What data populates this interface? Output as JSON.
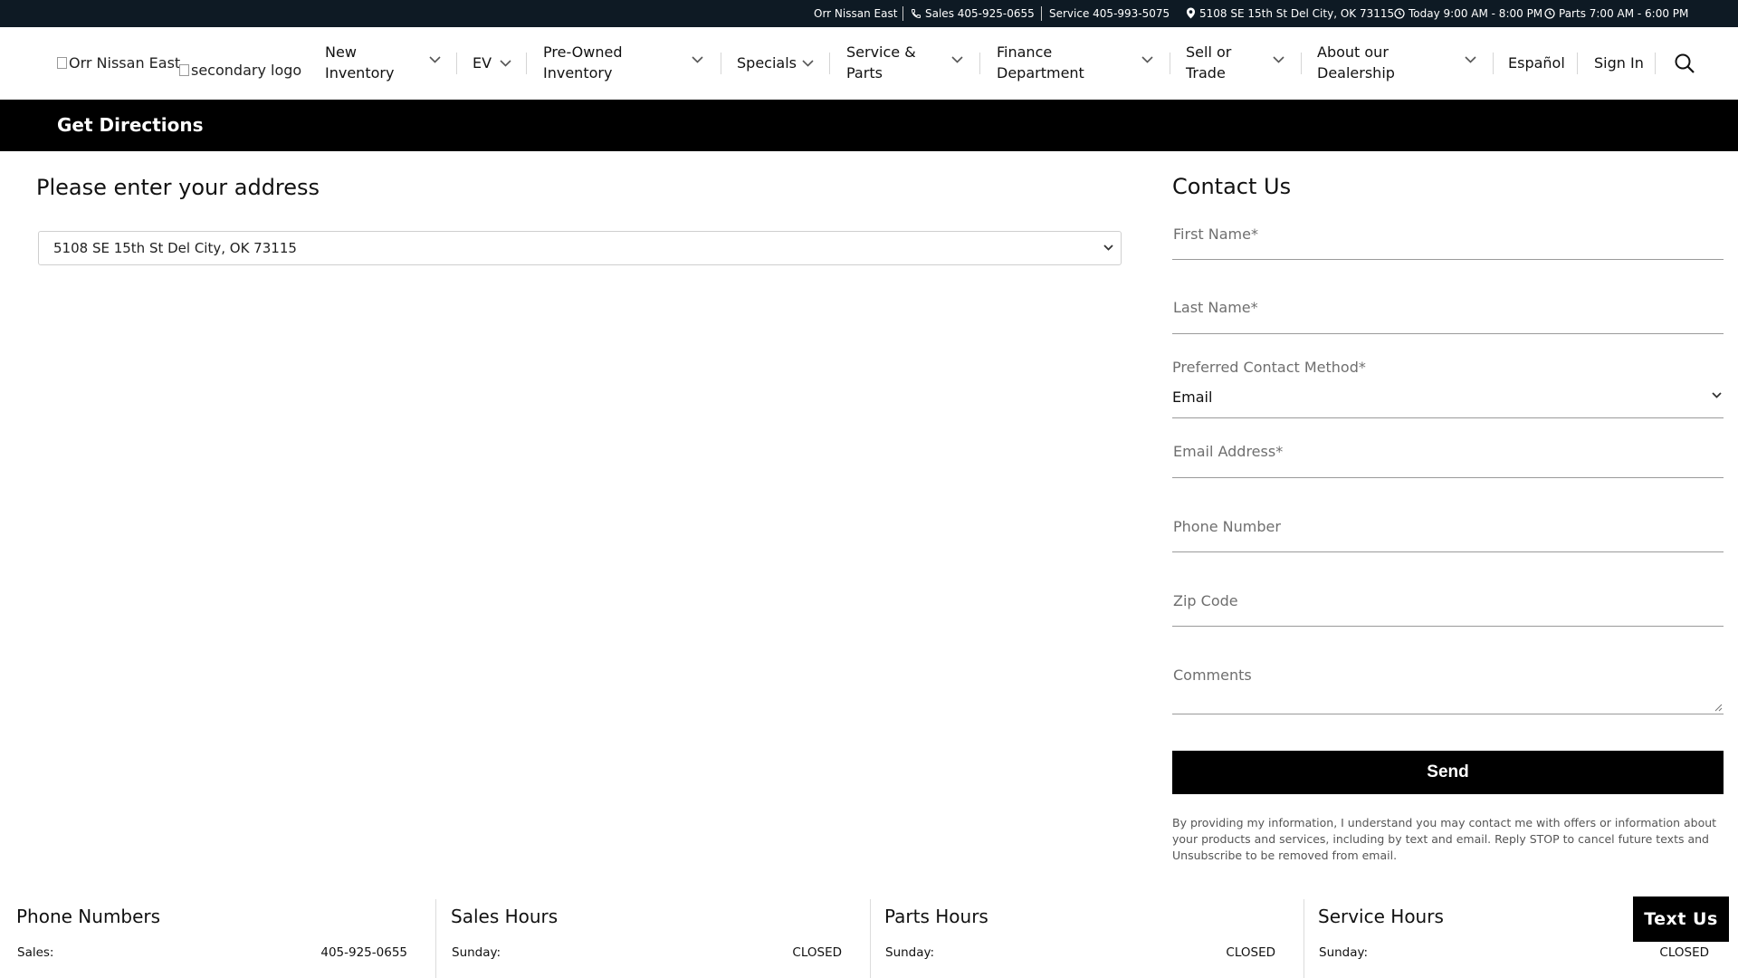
{
  "topbar": {
    "dealer_name": "Orr Nissan East",
    "sales": "Sales 405-925-0655",
    "service": "Service 405-993-5075",
    "address": "5108 SE 15th St Del City, OK 73115",
    "today_hours": "Today 9:00 AM - 8:00 PM",
    "parts_hours": "Parts 7:00 AM - 6:00 PM"
  },
  "header": {
    "logo_alt": "Orr Nissan East",
    "secondary_logo_alt": "secondary logo",
    "nav": [
      {
        "line1": "New",
        "line2": "Inventory"
      },
      {
        "line1": "EV",
        "line2": ""
      },
      {
        "line1": "Pre-Owned",
        "line2": "Inventory"
      },
      {
        "line1": "Specials",
        "line2": ""
      },
      {
        "line1": "Service &",
        "line2": "Parts"
      },
      {
        "line1": "Finance",
        "line2": "Department"
      },
      {
        "line1": "Sell or",
        "line2": "Trade"
      },
      {
        "line1": "About our",
        "line2": "Dealership"
      }
    ],
    "espanol": "Español",
    "sign_in": "Sign In"
  },
  "page": {
    "title": "Get Directions"
  },
  "address_section": {
    "title": "Please enter your address",
    "selected": "5108 SE 15th St Del City, OK 73115"
  },
  "contact": {
    "title": "Contact Us",
    "first_name": "First Name*",
    "last_name": "Last Name*",
    "preferred_label": "Preferred Contact Method*",
    "preferred_value": "Email",
    "email": "Email Address*",
    "phone": "Phone Number",
    "zip": "Zip Code",
    "comments": "Comments",
    "send": "Send",
    "disclaimer": "By providing my information, I understand you may contact me with offers or information about your products and services, including by text and email. Reply STOP to cancel future texts and Unsubscribe to be removed from email."
  },
  "footer": {
    "columns": [
      {
        "title": "Phone Numbers",
        "label": "Sales:",
        "value": "405-925-0655"
      },
      {
        "title": "Sales Hours",
        "label": "Sunday:",
        "value": "CLOSED"
      },
      {
        "title": "Parts Hours",
        "label": "Sunday:",
        "value": "CLOSED"
      },
      {
        "title": "Service Hours",
        "label": "Sunday:",
        "value": "CLOSED"
      }
    ]
  },
  "text_us": "Text Us",
  "colors": {
    "topbar_bg": "#0e1a24",
    "dirbar_bg": "#000000",
    "button_bg": "#000000"
  }
}
